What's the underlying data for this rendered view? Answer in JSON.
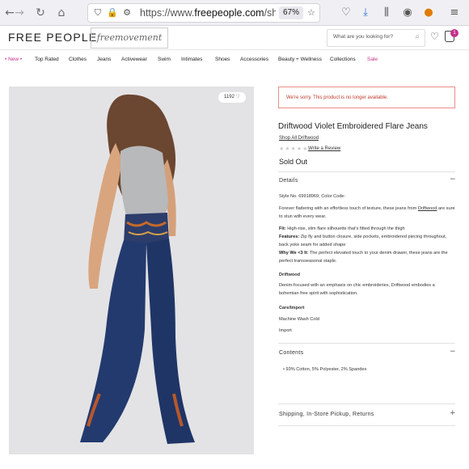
{
  "browser": {
    "back_icon": "arrow-left-icon",
    "forward_icon": "arrow-right-icon",
    "reload_icon": "reload-icon",
    "home_icon": "home-icon",
    "url_prefix": "https://www.",
    "url_domain": "freepeople.com",
    "url_rest": "/shop/d",
    "zoom": "67%",
    "bookmark_icon": "star-icon"
  },
  "site": {
    "logo": "FREE PEOPLE",
    "logo_secondary": "freemovement",
    "search_placeholder": "What are you looking for?",
    "bag_count": "1"
  },
  "categories": [
    "• New •",
    "Top Rated",
    "Clothes",
    "Jeans",
    "Activewear",
    "Swim",
    "Intimates",
    "Shoes",
    "Accessories",
    "Beauty + Wellness",
    "Collections",
    "Sale"
  ],
  "product": {
    "likes": "1192",
    "alert": "We're sorry. This product is no longer available.",
    "title": "Driftwood Violet Embroidered Flare Jeans",
    "shop_all": "Shop All Driftwood",
    "stars": "★★★★★",
    "write_review": "Write a Review",
    "status": "Sold Out"
  },
  "details": {
    "heading": "Details",
    "style_no": "Style No. 69918969; Color Code:",
    "intro": "Forever flattering with an effortless touch of texture, these jeans from",
    "intro_link": "Driftwood",
    "intro_end": " are sure to stun with every wear.",
    "fit_label": "Fit:",
    "fit": " High-rise, slim flare silhouette that's fitted through the thigh",
    "features_label": "Features:",
    "features": " Zip fly and button closure, side pockets, embroidered piecing throughout, back yoke seam for added shape",
    "why_label": "Why We <3 It:",
    "why": " The perfect elevated touch to your denim drawer, these jeans are the perfect transseasonal staple.",
    "brand_heading": "Driftwood",
    "brand_text": "Denim-focused with an emphasis on chic embroideries, Driftwood embodies a bohemian free spirit with sophistication.",
    "care_heading": "Care/Import",
    "care": "Machine Wash Cold",
    "import": "Import"
  },
  "contents": {
    "heading": "Contents",
    "text": "• 93% Cotton, 5% Polyester, 2% Spandex"
  },
  "shipping": {
    "heading": "Shipping, In-Store Pickup, Returns"
  }
}
